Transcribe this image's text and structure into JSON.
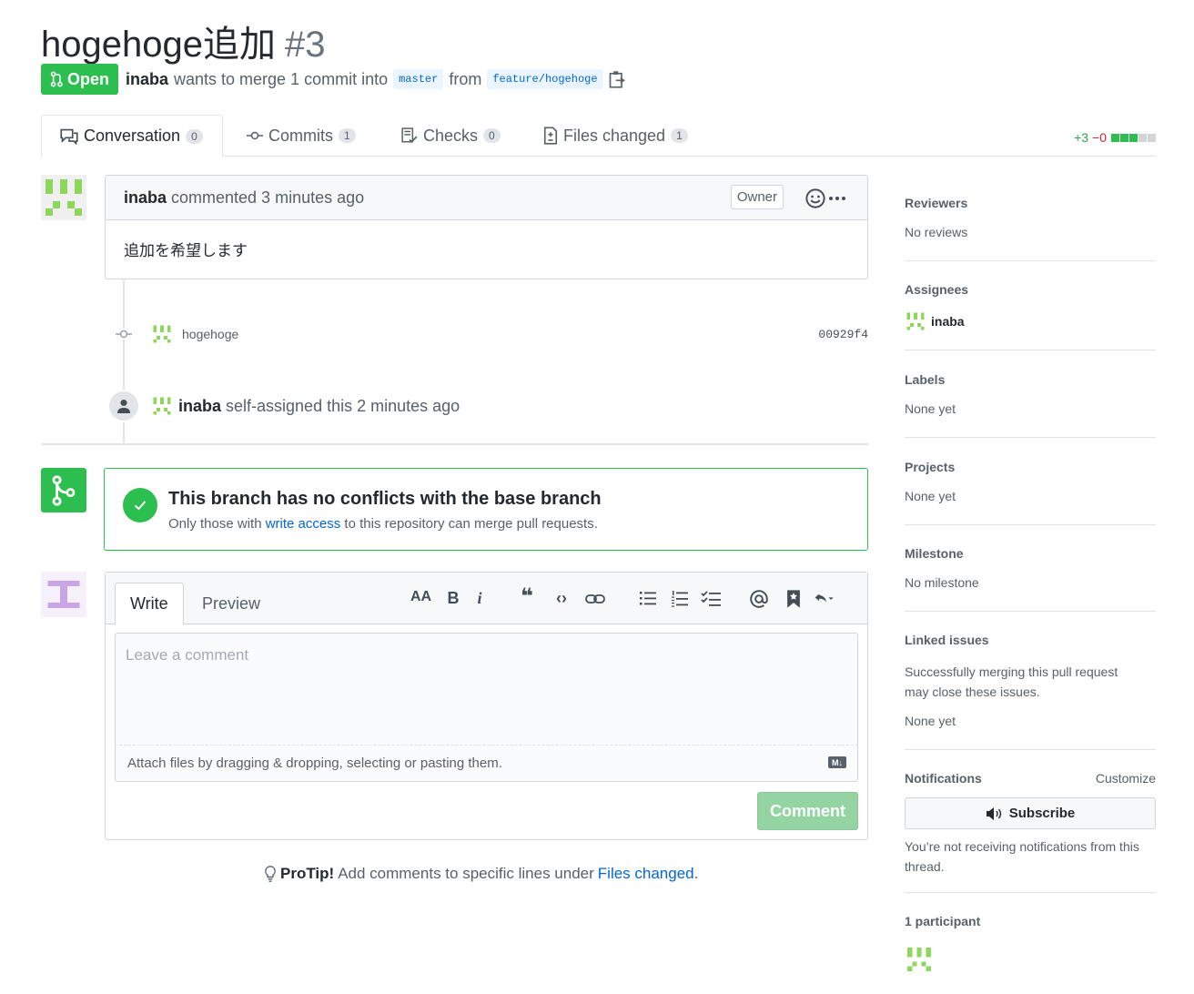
{
  "pr": {
    "title": "hogehoge追加",
    "number": "#3",
    "state": "Open",
    "author": "inaba",
    "merge_text": "wants to merge 1 commit into",
    "base_branch": "master",
    "from_text": "from",
    "head_branch": "feature/hogehoge"
  },
  "tabs": [
    {
      "label": "Conversation",
      "count": "0"
    },
    {
      "label": "Commits",
      "count": "1"
    },
    {
      "label": "Checks",
      "count": "0"
    },
    {
      "label": "Files changed",
      "count": "1"
    }
  ],
  "diffstat": {
    "additions": "+3",
    "deletions": "−0"
  },
  "comment": {
    "author": "inaba",
    "action": "commented 3 minutes ago",
    "role": "Owner",
    "body": "追加を希望します"
  },
  "commit": {
    "message": "hogehoge",
    "sha": "00929f4"
  },
  "event": {
    "actor": "inaba",
    "text": "self-assigned this 2 minutes ago"
  },
  "merge": {
    "title": "This branch has no conflicts with the base branch",
    "sub_before": "Only those with",
    "sub_link": "write access",
    "sub_after": "to this repository can merge pull requests."
  },
  "composer": {
    "tab_write": "Write",
    "tab_preview": "Preview",
    "placeholder": "Leave a comment",
    "attach_text": "Attach files by dragging & dropping, selecting or pasting them.",
    "submit": "Comment",
    "toolbar": {
      "header": "AA",
      "bold": "B",
      "italic": "i",
      "quote": "❝",
      "code": "‹›"
    }
  },
  "protip": {
    "label": "ProTip!",
    "text": "Add comments to specific lines under",
    "link": "Files changed",
    "end": "."
  },
  "sidebar": {
    "reviewers": {
      "heading": "Reviewers",
      "value": "No reviews"
    },
    "assignees": {
      "heading": "Assignees",
      "value": "inaba"
    },
    "labels": {
      "heading": "Labels",
      "value": "None yet"
    },
    "projects": {
      "heading": "Projects",
      "value": "None yet"
    },
    "milestone": {
      "heading": "Milestone",
      "value": "No milestone"
    },
    "linked": {
      "heading": "Linked issues",
      "desc": "Successfully merging this pull request may close these issues.",
      "value": "None yet"
    },
    "notifications": {
      "heading": "Notifications",
      "customize": "Customize",
      "button": "Subscribe",
      "desc": "You’re not receiving notifications from this thread."
    },
    "participants": {
      "heading": "1 participant"
    }
  },
  "colors": {
    "green": "#2cbe4e",
    "link": "#0366d6",
    "identicon": "#8fd65c",
    "identicon2": "#c9a5e6"
  }
}
